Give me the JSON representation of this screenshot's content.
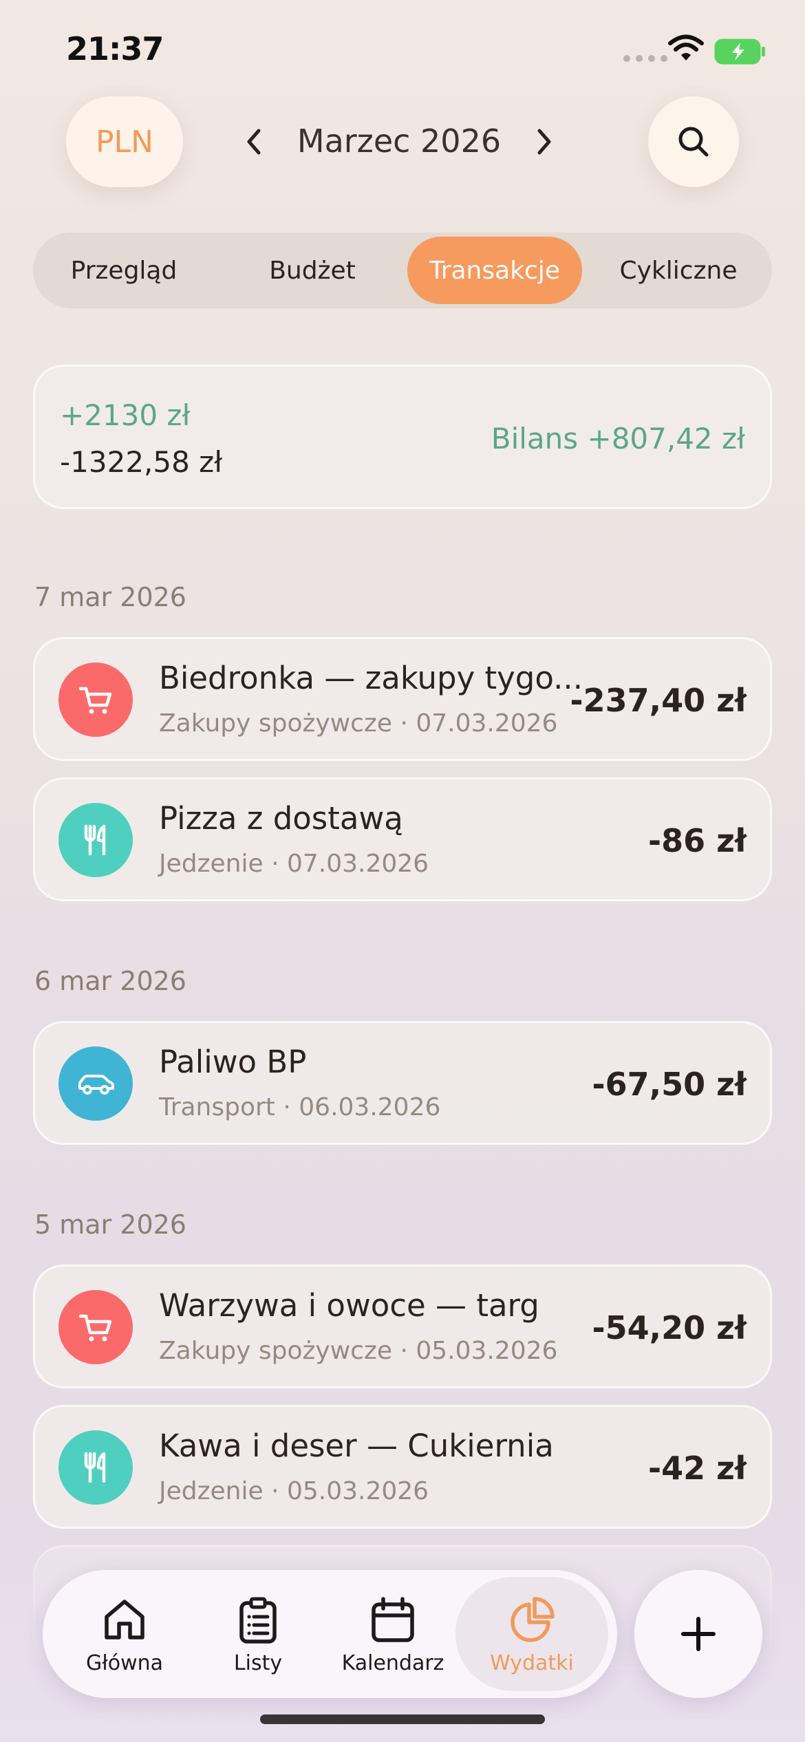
{
  "status_bar": {
    "time": "21:37"
  },
  "header": {
    "currency": "PLN",
    "month": "Marzec 2026",
    "prev_icon": "chevron-left-icon",
    "next_icon": "chevron-right-icon",
    "search_icon": "search-icon"
  },
  "tabs": [
    {
      "label": "Przegląd",
      "active": false
    },
    {
      "label": "Budżet",
      "active": false
    },
    {
      "label": "Transakcje",
      "active": true
    },
    {
      "label": "Cykliczne",
      "active": false
    }
  ],
  "summary": {
    "income": "+2130 zł",
    "expense": "-1322,58 zł",
    "balance": "Bilans +807,42 zł"
  },
  "days": [
    {
      "date": "7 mar 2026",
      "transactions": [
        {
          "title": "Biedronka — zakupy tygo...",
          "subtitle": "Zakupy spożywcze · 07.03.2026",
          "amount": "-237,40 zł",
          "icon": "cart-icon",
          "color": "#fb6a6a"
        },
        {
          "title": "Pizza z dostawą",
          "subtitle": "Jedzenie · 07.03.2026",
          "amount": "-86 zł",
          "icon": "fork-knife-icon",
          "color": "#4fcfbf"
        }
      ]
    },
    {
      "date": "6 mar 2026",
      "transactions": [
        {
          "title": "Paliwo BP",
          "subtitle": "Transport · 06.03.2026",
          "amount": "-67,50 zł",
          "icon": "car-icon",
          "color": "#40b4d4"
        }
      ]
    },
    {
      "date": "5 mar 2026",
      "transactions": [
        {
          "title": "Warzywa i owoce — targ",
          "subtitle": "Zakupy spożywcze · 05.03.2026",
          "amount": "-54,20 zł",
          "icon": "cart-icon",
          "color": "#fb6a6a"
        },
        {
          "title": "Kawa i deser — Cukiernia",
          "subtitle": "Jedzenie · 05.03.2026",
          "amount": "-42 zł",
          "icon": "fork-knife-icon",
          "color": "#4fcfbf"
        }
      ]
    }
  ],
  "bottom_nav": [
    {
      "label": "Główna",
      "icon": "home-icon",
      "active": false
    },
    {
      "label": "Listy",
      "icon": "clipboard-list-icon",
      "active": false
    },
    {
      "label": "Kalendarz",
      "icon": "calendar-icon",
      "active": false
    },
    {
      "label": "Wydatki",
      "icon": "pie-chart-icon",
      "active": true
    }
  ],
  "colors": {
    "accent": "#f79a5e",
    "income": "#5ba68a"
  }
}
